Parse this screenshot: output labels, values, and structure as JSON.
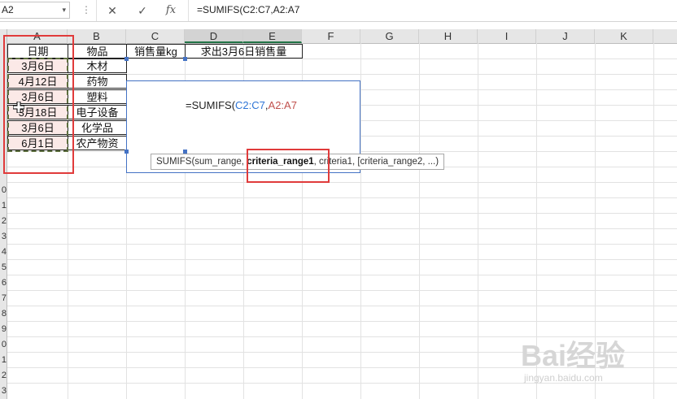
{
  "formula_bar": {
    "name_box": "A2",
    "name_box_arrow": "▾",
    "sep": "⋮",
    "cancel": "✕",
    "confirm": "✓",
    "fx": "fx",
    "formula": "=SUMIFS(C2:C7,A2:A7"
  },
  "columns": [
    "A",
    "B",
    "C",
    "D",
    "E",
    "F",
    "G",
    "H",
    "I",
    "J",
    "K"
  ],
  "row_numbers": [
    "0",
    "1",
    "2",
    "3",
    "4",
    "5",
    "6",
    "7",
    "8",
    "9",
    "0",
    "1",
    "2",
    "3"
  ],
  "headers": {
    "date": "日期",
    "item": "物品",
    "sales": "销售量kg",
    "task": "求出3月6日销售量"
  },
  "rows": [
    {
      "date": "3月6日",
      "item": "木材"
    },
    {
      "date": "4月12日",
      "item": "药物"
    },
    {
      "date": "3月6日",
      "item": "塑料"
    },
    {
      "date": "3月18日",
      "item": "电子设备"
    },
    {
      "date": "3月6日",
      "item": "化学品"
    },
    {
      "date": "6月1日",
      "item": "农产物资"
    }
  ],
  "editing": {
    "prefix": "=SUMIFS(",
    "ref1": "C2:C7",
    "comma": ",",
    "ref2": "A2:A7"
  },
  "tooltip": {
    "fn": "SUMIFS(sum_range, ",
    "current_arg": "criteria_range1",
    "rest": ", criteria1, [criteria_range2, ...)"
  },
  "watermark": {
    "brand": "Bai经验",
    "sub": "jingyan.baidu.com"
  },
  "colors": {
    "selected_header": "#217346",
    "ref_blue": "#2e75d6",
    "ref_red": "#c0504d",
    "highlight_red": "#e03b3b"
  }
}
